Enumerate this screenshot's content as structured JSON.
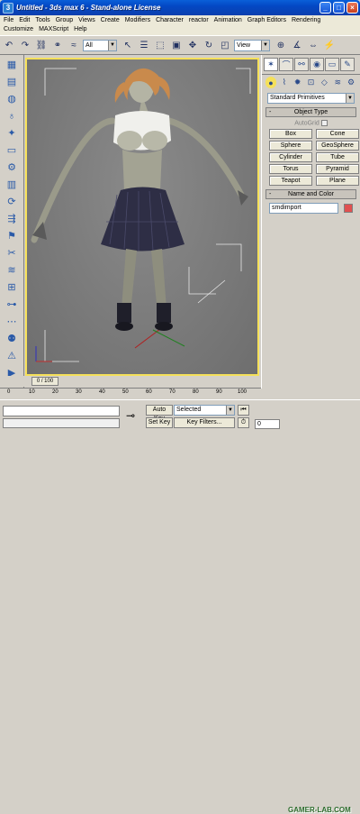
{
  "window": {
    "title": "Untitled  -  3ds max 6  -  Stand-alone License",
    "app_icon": "3"
  },
  "window_buttons": [
    "_",
    "□",
    "×"
  ],
  "menu": [
    "File",
    "Edit",
    "Tools",
    "Group",
    "Views",
    "Create",
    "Modifiers",
    "Character",
    "reactor",
    "Animation",
    "Graph Editors",
    "Rendering",
    "Customize",
    "MAXScript",
    "Help"
  ],
  "toolbar": {
    "selection_filter": "All",
    "ref_coord": "View"
  },
  "command_panel": {
    "category": "Standard Primitives",
    "object_type": {
      "header": "Object Type",
      "sign": "-",
      "autogrid": "AutoGrid"
    },
    "primitives": [
      "Box",
      "Cone",
      "Sphere",
      "GeoSphere",
      "Cylinder",
      "Tube",
      "Torus",
      "Pyramid",
      "Teapot",
      "Plane"
    ],
    "name_and_color": {
      "header": "Name and Color",
      "sign": "-",
      "name": "smdimport",
      "color": "#e05050"
    }
  },
  "timeline": {
    "slider": "0 / 100"
  },
  "ruler_ticks": [
    "0",
    "10",
    "20",
    "30",
    "40",
    "50",
    "60",
    "70",
    "80",
    "90",
    "100"
  ],
  "status": {
    "auto_key": "Auto Key",
    "set_key": "Set Key",
    "selected": "Selected",
    "key_filters": "Key Filters...",
    "frame": "0"
  },
  "watermark": "GAMER-LAB.COM"
}
